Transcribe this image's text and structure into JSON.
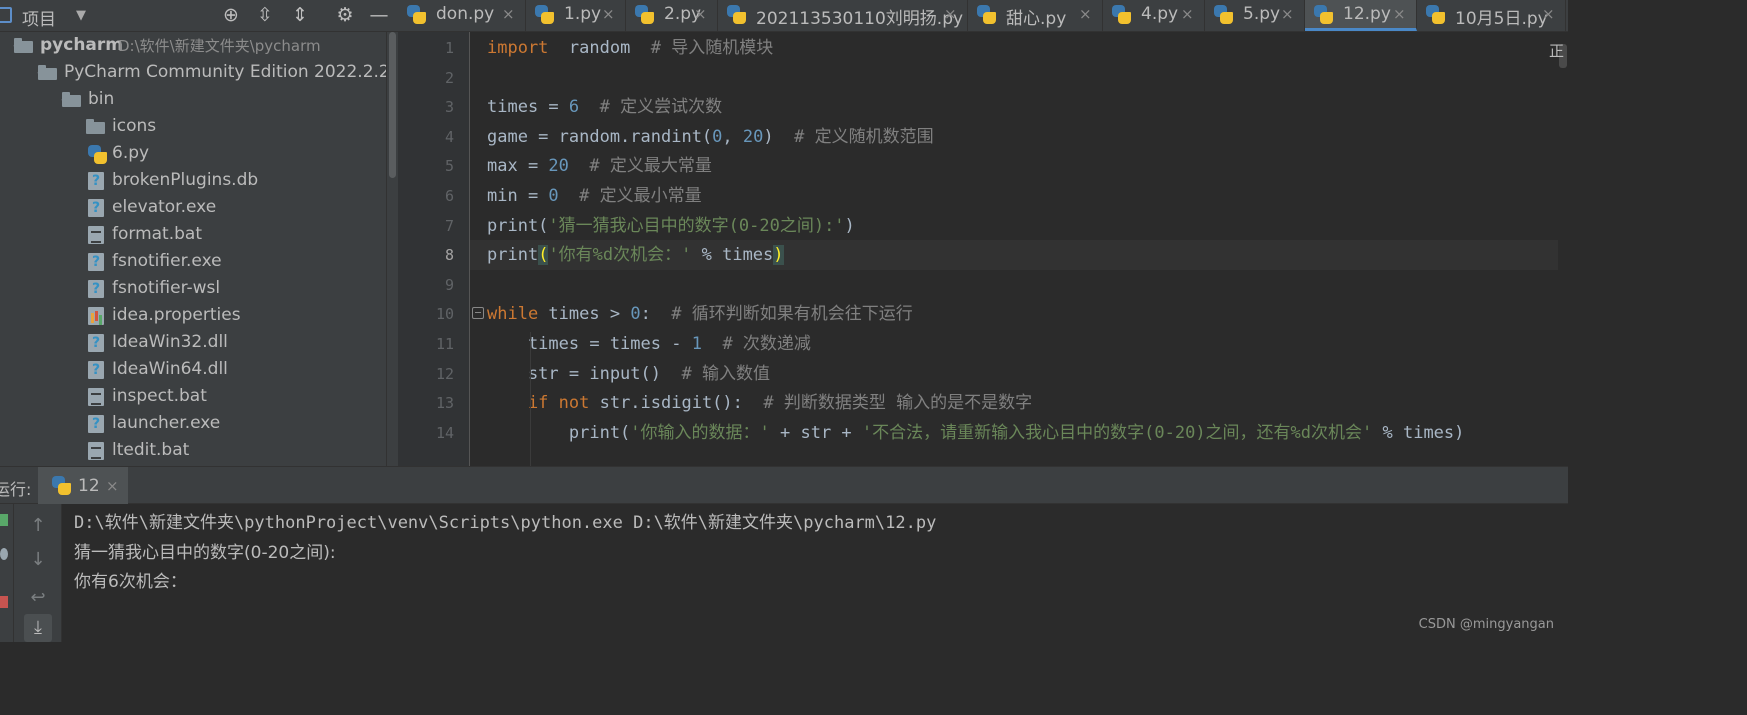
{
  "project_panel": {
    "title": "项目",
    "tree": [
      {
        "label": "pycharm",
        "path": "D:\\软件\\新建文件夹\\pycharm",
        "type": "folder",
        "depth": 0,
        "expanded": true,
        "bold": true
      },
      {
        "label": "PyCharm Community Edition 2022.2.2",
        "type": "folder",
        "depth": 1,
        "expanded": true
      },
      {
        "label": "bin",
        "type": "folder",
        "depth": 2,
        "expanded": true
      },
      {
        "label": "icons",
        "type": "folder",
        "depth": 3,
        "expanded": false
      },
      {
        "label": "6.py",
        "type": "python-file",
        "depth": 3
      },
      {
        "label": "brokenPlugins.db",
        "type": "unknown-file",
        "depth": 3
      },
      {
        "label": "elevator.exe",
        "type": "unknown-file",
        "depth": 3
      },
      {
        "label": "format.bat",
        "type": "text-file",
        "depth": 3
      },
      {
        "label": "fsnotifier.exe",
        "type": "unknown-file",
        "depth": 3
      },
      {
        "label": "fsnotifier-wsl",
        "type": "unknown-file",
        "depth": 3
      },
      {
        "label": "idea.properties",
        "type": "properties-file",
        "depth": 3
      },
      {
        "label": "IdeaWin32.dll",
        "type": "unknown-file",
        "depth": 3
      },
      {
        "label": "IdeaWin64.dll",
        "type": "unknown-file",
        "depth": 3
      },
      {
        "label": "inspect.bat",
        "type": "text-file",
        "depth": 3
      },
      {
        "label": "launcher.exe",
        "type": "unknown-file",
        "depth": 3
      },
      {
        "label": "ltedit.bat",
        "type": "text-file",
        "depth": 3
      }
    ]
  },
  "tabs": [
    {
      "label": "don.py",
      "active": false
    },
    {
      "label": "1.py",
      "active": false
    },
    {
      "label": "2.py",
      "active": false
    },
    {
      "label": "202113530110刘明扬.py",
      "active": false
    },
    {
      "label": "甜心.py",
      "active": false
    },
    {
      "label": "4.py",
      "active": false
    },
    {
      "label": "5.py",
      "active": false
    },
    {
      "label": "12.py",
      "active": true
    },
    {
      "label": "10月5日.py",
      "active": false
    }
  ],
  "tab_close_glyph": "×",
  "editor": {
    "current_line": 8,
    "reader_mode_glyph": "正",
    "lines": [
      {
        "n": "1",
        "tokens": [
          [
            "kw",
            "import"
          ],
          [
            "",
            "  random  "
          ],
          [
            "cmt",
            "# 导入随机模块"
          ]
        ]
      },
      {
        "n": "2",
        "tokens": []
      },
      {
        "n": "3",
        "tokens": [
          [
            "",
            "times = "
          ],
          [
            "num",
            "6"
          ],
          [
            "",
            "  "
          ],
          [
            "cmt",
            "# 定义尝试次数"
          ]
        ]
      },
      {
        "n": "4",
        "tokens": [
          [
            "",
            "game = random.randint("
          ],
          [
            "num",
            "0"
          ],
          [
            "",
            ", "
          ],
          [
            "num",
            "20"
          ],
          [
            "",
            ")  "
          ],
          [
            "cmt",
            "# 定义随机数范围"
          ]
        ]
      },
      {
        "n": "5",
        "tokens": [
          [
            "",
            "max = "
          ],
          [
            "num",
            "20"
          ],
          [
            "",
            "  "
          ],
          [
            "cmt",
            "# 定义最大常量"
          ]
        ]
      },
      {
        "n": "6",
        "tokens": [
          [
            "",
            "min = "
          ],
          [
            "num",
            "0"
          ],
          [
            "",
            "  "
          ],
          [
            "cmt",
            "# 定义最小常量"
          ]
        ]
      },
      {
        "n": "7",
        "tokens": [
          [
            "",
            "print("
          ],
          [
            "str",
            "'猜一猜我心目中的数字(0-20之间):'"
          ],
          [
            "",
            ")"
          ]
        ]
      },
      {
        "n": "8",
        "tokens": [
          [
            "",
            "print"
          ],
          [
            "brace",
            "("
          ],
          [
            "str",
            "'你有%d次机会：'"
          ],
          [
            "",
            " % times"
          ],
          [
            "brace",
            ")"
          ]
        ]
      },
      {
        "n": "9",
        "tokens": []
      },
      {
        "n": "10",
        "tokens": [
          [
            "kw",
            "while"
          ],
          [
            "",
            " times > "
          ],
          [
            "num",
            "0"
          ],
          [
            "",
            ":  "
          ],
          [
            "cmt",
            "# 循环判断如果有机会往下运行"
          ]
        ]
      },
      {
        "n": "11",
        "tokens": [
          [
            "",
            "    times = times - "
          ],
          [
            "num",
            "1"
          ],
          [
            "",
            "  "
          ],
          [
            "cmt",
            "# 次数递减"
          ]
        ]
      },
      {
        "n": "12",
        "tokens": [
          [
            "",
            "    str = input()  "
          ],
          [
            "cmt",
            "# 输入数值"
          ]
        ]
      },
      {
        "n": "13",
        "tokens": [
          [
            "kw",
            "    if not"
          ],
          [
            "",
            " str.isdigit():  "
          ],
          [
            "cmt",
            "# 判断数据类型 输入的是不是数字"
          ]
        ]
      },
      {
        "n": "14",
        "tokens": [
          [
            "",
            "        print("
          ],
          [
            "str",
            "'你输入的数据：'"
          ],
          [
            "",
            " + str + "
          ],
          [
            "str",
            "'不合法，请重新输入我心目中的数字(0-20)之间，还有%d次机会'"
          ],
          [
            "",
            " % times)"
          ]
        ]
      }
    ]
  },
  "run_panel": {
    "label": "运行:",
    "tab_label": "12",
    "tab_close": "×",
    "output": [
      "D:\\软件\\新建文件夹\\pythonProject\\venv\\Scripts\\python.exe D:\\软件\\新建文件夹\\pycharm\\12.py",
      "猜一猜我心目中的数字(0-20之间):",
      "你有6次机会："
    ]
  },
  "watermark": "CSDN @mingyangan",
  "colors": {
    "keyword": "#cc7832",
    "number": "#6897bb",
    "string": "#6a8759",
    "comment": "#808080",
    "accent": "#4a88c7"
  }
}
